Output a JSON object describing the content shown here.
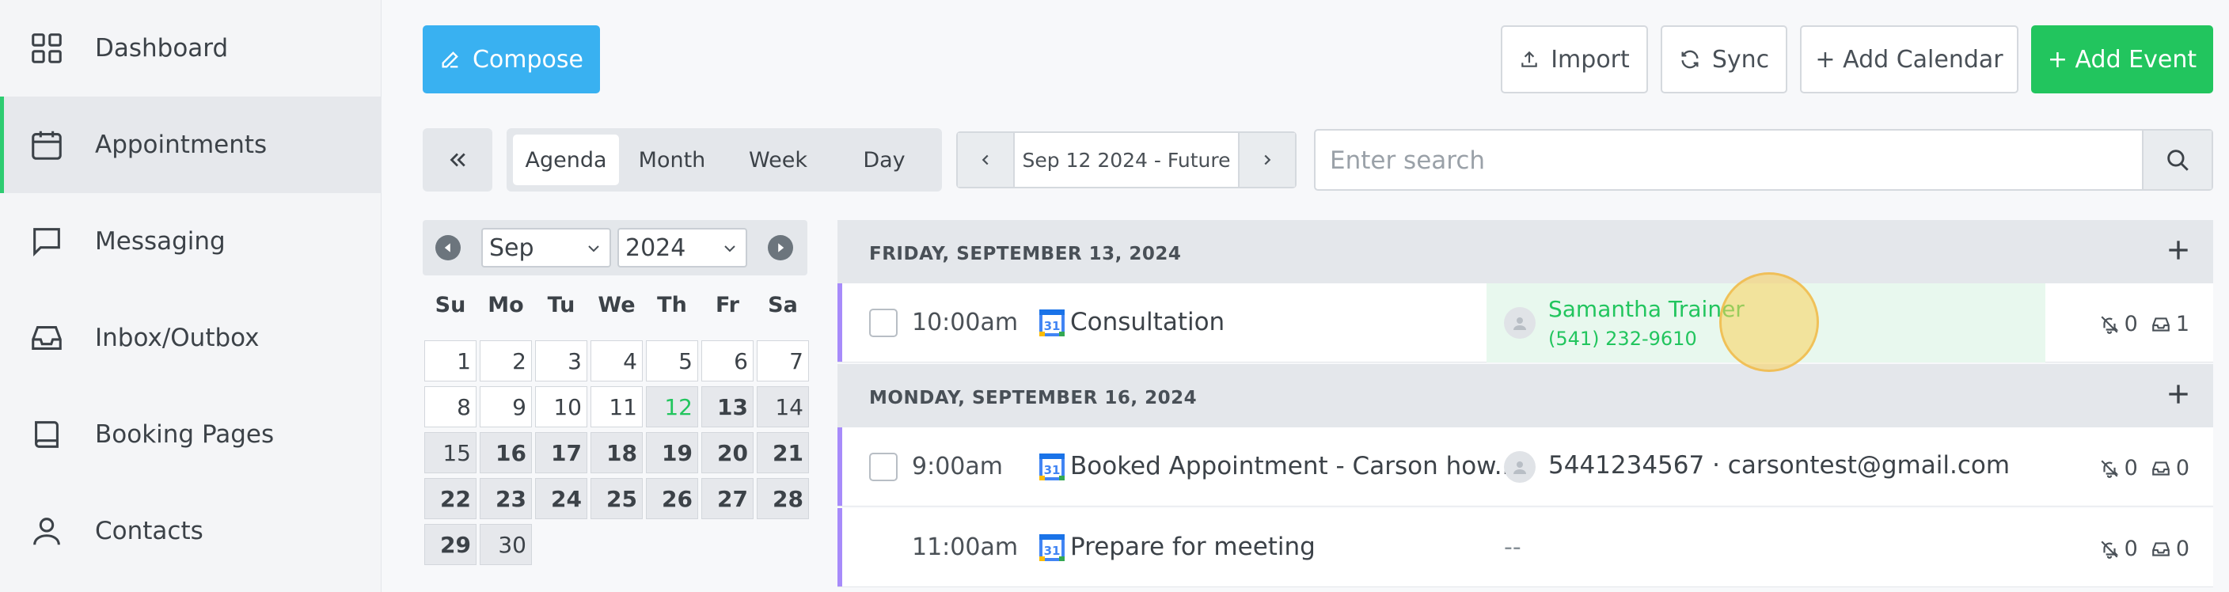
{
  "sidebar": {
    "items": [
      {
        "label": "Dashboard",
        "icon": "dashboard-icon",
        "active": false
      },
      {
        "label": "Appointments",
        "icon": "calendar-icon",
        "active": true
      },
      {
        "label": "Messaging",
        "icon": "message-icon",
        "active": false
      },
      {
        "label": "Inbox/Outbox",
        "icon": "inbox-icon",
        "active": false
      },
      {
        "label": "Booking Pages",
        "icon": "book-icon",
        "active": false
      },
      {
        "label": "Contacts",
        "icon": "user-icon",
        "active": false
      }
    ]
  },
  "toolbar": {
    "compose": "Compose",
    "import": "Import",
    "sync": "Sync",
    "add_calendar": "+ Add Calendar",
    "add_event": "+ Add Event"
  },
  "views": {
    "agenda": "Agenda",
    "month": "Month",
    "week": "Week",
    "day": "Day",
    "selected": "Agenda"
  },
  "date_range": "Sep 12 2024 - Future",
  "search": {
    "placeholder": "Enter search"
  },
  "mini_calendar": {
    "month": "Sep",
    "year": "2024",
    "weekdays": [
      "Su",
      "Mo",
      "Tu",
      "We",
      "Th",
      "Fr",
      "Sa"
    ],
    "today": "12"
  },
  "agenda": {
    "groups": [
      {
        "date": "FRIDAY, SEPTEMBER 13, 2024",
        "events": [
          {
            "time": "10:00am",
            "title": "Consultation",
            "contact_name": "Samantha Trainer",
            "contact_phone": "(541) 232-9610",
            "reminders": "0",
            "messages": "1"
          }
        ]
      },
      {
        "date": "MONDAY, SEPTEMBER 16, 2024",
        "events": [
          {
            "time": "9:00am",
            "title": "Booked Appointment - Carson how...",
            "contact": "5441234567 · carsontest@gmail.com",
            "reminders": "0",
            "messages": "0"
          },
          {
            "time": "11:00am",
            "title": "Prepare for meeting",
            "contact": "--",
            "reminders": "0",
            "messages": "0"
          }
        ]
      }
    ]
  },
  "colors": {
    "accent_green": "#22c55e",
    "compose_blue": "#39b1f1",
    "event_bar": "#a78bfa"
  }
}
